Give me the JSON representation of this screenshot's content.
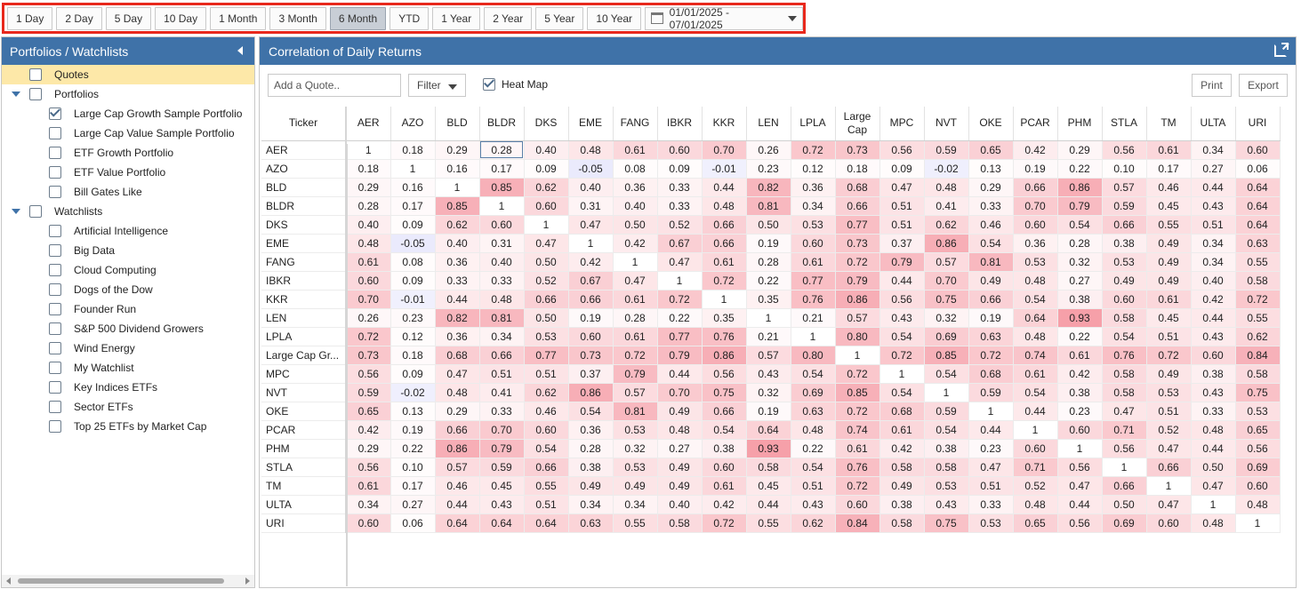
{
  "toolbar": {
    "ranges": [
      "1 Day",
      "2 Day",
      "5 Day",
      "10 Day",
      "1 Month",
      "3 Month",
      "6 Month",
      "YTD",
      "1 Year",
      "2 Year",
      "5 Year",
      "10 Year"
    ],
    "active_range": "6 Month",
    "date_range": "01/01/2025 - 07/01/2025"
  },
  "sidebar": {
    "title": "Portfolios / Watchlists",
    "quotes_label": "Quotes",
    "portfolios_label": "Portfolios",
    "portfolios": [
      {
        "label": "Large Cap Growth Sample Portfolio",
        "checked": true
      },
      {
        "label": "Large Cap Value Sample Portfolio",
        "checked": false
      },
      {
        "label": "ETF Growth Portfolio",
        "checked": false
      },
      {
        "label": "ETF Value Portfolio",
        "checked": false
      },
      {
        "label": "Bill Gates Like",
        "checked": false
      }
    ],
    "watchlists_label": "Watchlists",
    "watchlists": [
      "Artificial Intelligence",
      "Big Data",
      "Cloud Computing",
      "Dogs of the Dow",
      "Founder Run",
      "S&P 500 Dividend Growers",
      "Wind Energy",
      "My Watchlist",
      "Key Indices ETFs",
      "Sector ETFs",
      "Top 25 ETFs by Market Cap"
    ]
  },
  "main": {
    "title": "Correlation of Daily Returns",
    "add_quote_placeholder": "Add a Quote..",
    "filter_label": "Filter",
    "heatmap_label": "Heat Map",
    "heatmap_checked": true,
    "print_label": "Print",
    "export_label": "Export",
    "ticker_header": "Ticker",
    "columns": [
      "AER",
      "AZO",
      "BLD",
      "BLDR",
      "DKS",
      "EME",
      "FANG",
      "IBKR",
      "KKR",
      "LEN",
      "LPLA",
      "Large Cap",
      "MPC",
      "NVT",
      "OKE",
      "PCAR",
      "PHM",
      "STLA",
      "TM",
      "ULTA",
      "URI"
    ],
    "rows": [
      {
        "ticker": "AER",
        "values": [
          "1",
          "0.18",
          "0.29",
          "0.28",
          "0.40",
          "0.48",
          "0.61",
          "0.60",
          "0.70",
          "0.26",
          "0.72",
          "0.73",
          "0.56",
          "0.59",
          "0.65",
          "0.42",
          "0.29",
          "0.56",
          "0.61",
          "0.34",
          "0.60"
        ]
      },
      {
        "ticker": "AZO",
        "values": [
          "0.18",
          "1",
          "0.16",
          "0.17",
          "0.09",
          "-0.05",
          "0.08",
          "0.09",
          "-0.01",
          "0.23",
          "0.12",
          "0.18",
          "0.09",
          "-0.02",
          "0.13",
          "0.19",
          "0.22",
          "0.10",
          "0.17",
          "0.27",
          "0.06"
        ]
      },
      {
        "ticker": "BLD",
        "values": [
          "0.29",
          "0.16",
          "1",
          "0.85",
          "0.62",
          "0.40",
          "0.36",
          "0.33",
          "0.44",
          "0.82",
          "0.36",
          "0.68",
          "0.47",
          "0.48",
          "0.29",
          "0.66",
          "0.86",
          "0.57",
          "0.46",
          "0.44",
          "0.64"
        ]
      },
      {
        "ticker": "BLDR",
        "values": [
          "0.28",
          "0.17",
          "0.85",
          "1",
          "0.60",
          "0.31",
          "0.40",
          "0.33",
          "0.48",
          "0.81",
          "0.34",
          "0.66",
          "0.51",
          "0.41",
          "0.33",
          "0.70",
          "0.79",
          "0.59",
          "0.45",
          "0.43",
          "0.64"
        ]
      },
      {
        "ticker": "DKS",
        "values": [
          "0.40",
          "0.09",
          "0.62",
          "0.60",
          "1",
          "0.47",
          "0.50",
          "0.52",
          "0.66",
          "0.50",
          "0.53",
          "0.77",
          "0.51",
          "0.62",
          "0.46",
          "0.60",
          "0.54",
          "0.66",
          "0.55",
          "0.51",
          "0.64"
        ]
      },
      {
        "ticker": "EME",
        "values": [
          "0.48",
          "-0.05",
          "0.40",
          "0.31",
          "0.47",
          "1",
          "0.42",
          "0.67",
          "0.66",
          "0.19",
          "0.60",
          "0.73",
          "0.37",
          "0.86",
          "0.54",
          "0.36",
          "0.28",
          "0.38",
          "0.49",
          "0.34",
          "0.63"
        ]
      },
      {
        "ticker": "FANG",
        "values": [
          "0.61",
          "0.08",
          "0.36",
          "0.40",
          "0.50",
          "0.42",
          "1",
          "0.47",
          "0.61",
          "0.28",
          "0.61",
          "0.72",
          "0.79",
          "0.57",
          "0.81",
          "0.53",
          "0.32",
          "0.53",
          "0.49",
          "0.34",
          "0.55"
        ]
      },
      {
        "ticker": "IBKR",
        "values": [
          "0.60",
          "0.09",
          "0.33",
          "0.33",
          "0.52",
          "0.67",
          "0.47",
          "1",
          "0.72",
          "0.22",
          "0.77",
          "0.79",
          "0.44",
          "0.70",
          "0.49",
          "0.48",
          "0.27",
          "0.49",
          "0.49",
          "0.40",
          "0.58"
        ]
      },
      {
        "ticker": "KKR",
        "values": [
          "0.70",
          "-0.01",
          "0.44",
          "0.48",
          "0.66",
          "0.66",
          "0.61",
          "0.72",
          "1",
          "0.35",
          "0.76",
          "0.86",
          "0.56",
          "0.75",
          "0.66",
          "0.54",
          "0.38",
          "0.60",
          "0.61",
          "0.42",
          "0.72"
        ]
      },
      {
        "ticker": "LEN",
        "values": [
          "0.26",
          "0.23",
          "0.82",
          "0.81",
          "0.50",
          "0.19",
          "0.28",
          "0.22",
          "0.35",
          "1",
          "0.21",
          "0.57",
          "0.43",
          "0.32",
          "0.19",
          "0.64",
          "0.93",
          "0.58",
          "0.45",
          "0.44",
          "0.55"
        ]
      },
      {
        "ticker": "LPLA",
        "values": [
          "0.72",
          "0.12",
          "0.36",
          "0.34",
          "0.53",
          "0.60",
          "0.61",
          "0.77",
          "0.76",
          "0.21",
          "1",
          "0.80",
          "0.54",
          "0.69",
          "0.63",
          "0.48",
          "0.22",
          "0.54",
          "0.51",
          "0.43",
          "0.62"
        ]
      },
      {
        "ticker": "Large Cap Gr...",
        "values": [
          "0.73",
          "0.18",
          "0.68",
          "0.66",
          "0.77",
          "0.73",
          "0.72",
          "0.79",
          "0.86",
          "0.57",
          "0.80",
          "1",
          "0.72",
          "0.85",
          "0.72",
          "0.74",
          "0.61",
          "0.76",
          "0.72",
          "0.60",
          "0.84"
        ]
      },
      {
        "ticker": "MPC",
        "values": [
          "0.56",
          "0.09",
          "0.47",
          "0.51",
          "0.51",
          "0.37",
          "0.79",
          "0.44",
          "0.56",
          "0.43",
          "0.54",
          "0.72",
          "1",
          "0.54",
          "0.68",
          "0.61",
          "0.42",
          "0.58",
          "0.49",
          "0.38",
          "0.58"
        ]
      },
      {
        "ticker": "NVT",
        "values": [
          "0.59",
          "-0.02",
          "0.48",
          "0.41",
          "0.62",
          "0.86",
          "0.57",
          "0.70",
          "0.75",
          "0.32",
          "0.69",
          "0.85",
          "0.54",
          "1",
          "0.59",
          "0.54",
          "0.38",
          "0.58",
          "0.53",
          "0.43",
          "0.75"
        ]
      },
      {
        "ticker": "OKE",
        "values": [
          "0.65",
          "0.13",
          "0.29",
          "0.33",
          "0.46",
          "0.54",
          "0.81",
          "0.49",
          "0.66",
          "0.19",
          "0.63",
          "0.72",
          "0.68",
          "0.59",
          "1",
          "0.44",
          "0.23",
          "0.47",
          "0.51",
          "0.33",
          "0.53"
        ]
      },
      {
        "ticker": "PCAR",
        "values": [
          "0.42",
          "0.19",
          "0.66",
          "0.70",
          "0.60",
          "0.36",
          "0.53",
          "0.48",
          "0.54",
          "0.64",
          "0.48",
          "0.74",
          "0.61",
          "0.54",
          "0.44",
          "1",
          "0.60",
          "0.71",
          "0.52",
          "0.48",
          "0.65"
        ]
      },
      {
        "ticker": "PHM",
        "values": [
          "0.29",
          "0.22",
          "0.86",
          "0.79",
          "0.54",
          "0.28",
          "0.32",
          "0.27",
          "0.38",
          "0.93",
          "0.22",
          "0.61",
          "0.42",
          "0.38",
          "0.23",
          "0.60",
          "1",
          "0.56",
          "0.47",
          "0.44",
          "0.56"
        ]
      },
      {
        "ticker": "STLA",
        "values": [
          "0.56",
          "0.10",
          "0.57",
          "0.59",
          "0.66",
          "0.38",
          "0.53",
          "0.49",
          "0.60",
          "0.58",
          "0.54",
          "0.76",
          "0.58",
          "0.58",
          "0.47",
          "0.71",
          "0.56",
          "1",
          "0.66",
          "0.50",
          "0.69"
        ]
      },
      {
        "ticker": "TM",
        "values": [
          "0.61",
          "0.17",
          "0.46",
          "0.45",
          "0.55",
          "0.49",
          "0.49",
          "0.49",
          "0.61",
          "0.45",
          "0.51",
          "0.72",
          "0.49",
          "0.53",
          "0.51",
          "0.52",
          "0.47",
          "0.66",
          "1",
          "0.47",
          "0.60"
        ]
      },
      {
        "ticker": "ULTA",
        "values": [
          "0.34",
          "0.27",
          "0.44",
          "0.43",
          "0.51",
          "0.34",
          "0.34",
          "0.40",
          "0.42",
          "0.44",
          "0.43",
          "0.60",
          "0.38",
          "0.43",
          "0.33",
          "0.48",
          "0.44",
          "0.50",
          "0.47",
          "1",
          "0.48"
        ]
      },
      {
        "ticker": "URI",
        "values": [
          "0.60",
          "0.06",
          "0.64",
          "0.64",
          "0.64",
          "0.63",
          "0.55",
          "0.58",
          "0.72",
          "0.55",
          "0.62",
          "0.84",
          "0.58",
          "0.75",
          "0.53",
          "0.65",
          "0.56",
          "0.69",
          "0.60",
          "0.48",
          "1"
        ]
      }
    ]
  },
  "colors": {
    "header_blue": "#3f72a8",
    "highlight_red": "#e8281c",
    "heat_positive": "#f06a78",
    "heat_negative": "#8c8cf0",
    "quotes_highlight": "#fde8a8"
  }
}
